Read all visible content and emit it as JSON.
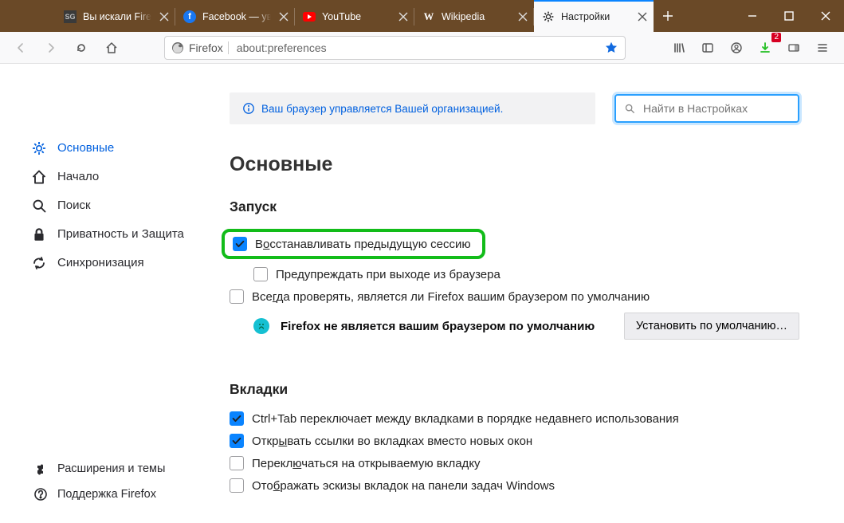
{
  "tabs": {
    "t0": {
      "label": "Вы искали Firefo"
    },
    "t1": {
      "label": "Facebook — уви"
    },
    "t2": {
      "label": "YouTube"
    },
    "t3": {
      "label": "Wikipedia"
    },
    "t4": {
      "label": "Настройки"
    }
  },
  "urlbar": {
    "identity_label": "Firefox",
    "url": "about:preferences"
  },
  "toolbar": {
    "download_badge": "2"
  },
  "banner": {
    "text": "Ваш браузер управляется Вашей организацией."
  },
  "search": {
    "placeholder": "Найти в Настройках"
  },
  "sidebar": {
    "general": "Основные",
    "home": "Начало",
    "search": "Поиск",
    "privacy": "Приватность и Защита",
    "sync": "Синхронизация",
    "addons": "Расширения и темы",
    "support": "Поддержка Firefox"
  },
  "content": {
    "title": "Основные",
    "startup": {
      "title": "Запуск",
      "restore_pre": "В",
      "restore_u": "о",
      "restore_post": "сстанавливать предыдущую сессию",
      "warn": "Предупреждать при выходе из браузера",
      "always_pre": "Все",
      "always_u": "г",
      "always_post": "да проверять, является ли Firefox вашим браузером по умолчанию",
      "not_default": "Firefox не является вашим браузером по умолчанию",
      "set_default_pre": "Уста",
      "set_default_u": "н",
      "set_default_post": "овить по умолчанию…"
    },
    "tabs": {
      "title": "Вкладки",
      "ctrltab": "Ctrl+Tab переключает между вкладками в порядке недавнего использования",
      "open_pre": "Откр",
      "open_u": "ы",
      "open_post": "вать ссылки во вкладках вместо новых окон",
      "switch_pre": "Перекл",
      "switch_u": "ю",
      "switch_post": "чаться на открываемую вкладку",
      "thumbs_pre": "Ото",
      "thumbs_u": "б",
      "thumbs_post": "ражать эскизы вкладок на панели задач Windows"
    }
  }
}
